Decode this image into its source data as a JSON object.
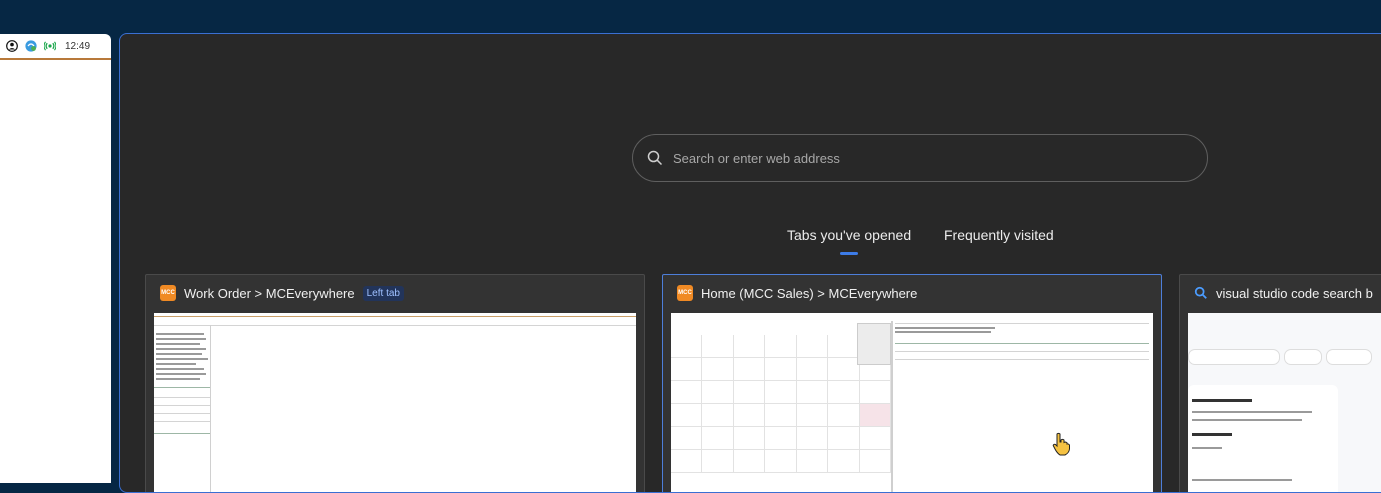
{
  "taskbar": {
    "clock": "12:49",
    "icons": [
      "user-icon",
      "globe-sync-icon",
      "wifi-broadcast-icon"
    ]
  },
  "search": {
    "placeholder": "Search or enter web address"
  },
  "tabs": [
    {
      "label": "Tabs you've opened",
      "active": true
    },
    {
      "label": "Frequently visited",
      "active": false
    }
  ],
  "cards": [
    {
      "title": "Work Order > MCEverywhere",
      "badge": "Left tab",
      "favicon": "mcc-favicon"
    },
    {
      "title": "Home (MCC Sales) > MCEverywhere",
      "favicon": "mcc-favicon"
    },
    {
      "title": "visual studio code search b",
      "favicon": "search-icon"
    }
  ],
  "colors": {
    "desktop": "#062744",
    "panel": "#282828",
    "accent": "#3d7ce8",
    "favicon": "#f08a24"
  }
}
